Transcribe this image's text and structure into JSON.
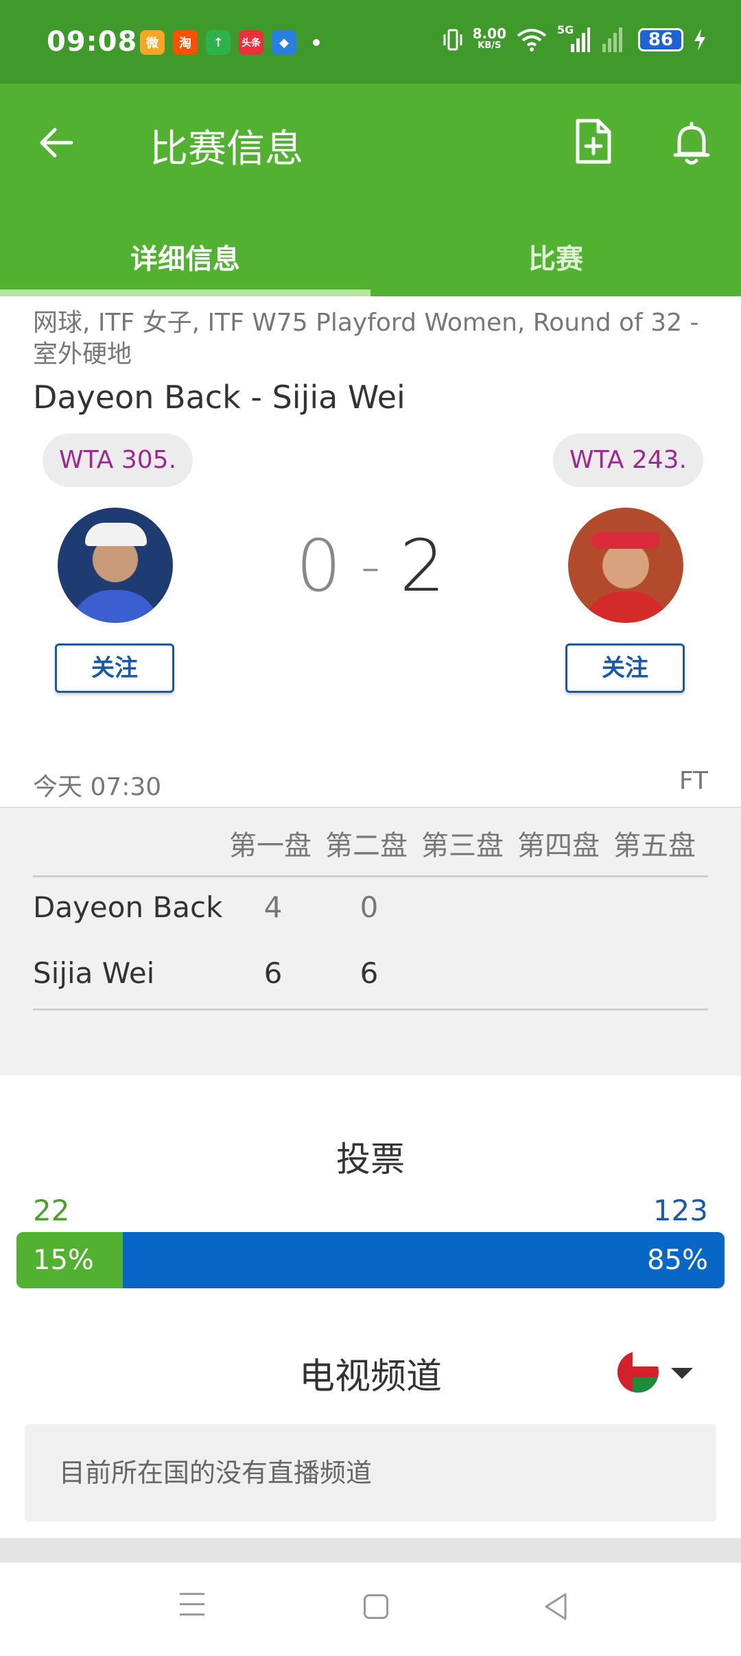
{
  "status_bar": {
    "time": "09:08",
    "net_speed": "8.00",
    "net_unit": "KB/S",
    "network": "5G",
    "battery": "86",
    "apps": [
      {
        "name": "weibo",
        "label": "微",
        "color": "#f5a623"
      },
      {
        "name": "taobao",
        "label": "淘",
        "color": "#ff5000"
      },
      {
        "name": "green-app",
        "label": "↑",
        "color": "#2db34a"
      },
      {
        "name": "toutiao",
        "label": "头条",
        "color": "#e8313a"
      },
      {
        "name": "blue-app",
        "label": "◆",
        "color": "#2a7de1"
      }
    ]
  },
  "app_bar": {
    "title": "比赛信息",
    "tabs": [
      {
        "label": "详细信息",
        "active": true
      },
      {
        "label": "比赛",
        "active": false
      }
    ]
  },
  "match": {
    "meta_line1": "网球, ITF 女子, ITF W75 Playford Women, Round of 32 -",
    "meta_line2": "室外硬地",
    "players_title": "Dayeon Back - Sijia Wei",
    "left_rank": "WTA 305.",
    "right_rank": "WTA 243.",
    "score_left": "0",
    "score_sep": "-",
    "score_right": "2",
    "follow_label": "关注",
    "datetime": "今天 07:30",
    "status": "FT"
  },
  "sets": {
    "headers": [
      "第一盘",
      "第二盘",
      "第三盘",
      "第四盘",
      "第五盘"
    ],
    "rows": [
      {
        "name": "Dayeon Back",
        "scores": [
          "4",
          "0"
        ]
      },
      {
        "name": "Sijia Wei",
        "scores": [
          "6",
          "6"
        ]
      }
    ]
  },
  "vote": {
    "title": "投票",
    "left_count": "22",
    "right_count": "123",
    "left_percent": "15%",
    "right_percent": "85%",
    "left_fraction": 0.15,
    "left_color": "#52b131",
    "right_color": "#0866c6"
  },
  "tv": {
    "title": "电视频道",
    "message": "目前所在国的没有直播频道"
  }
}
